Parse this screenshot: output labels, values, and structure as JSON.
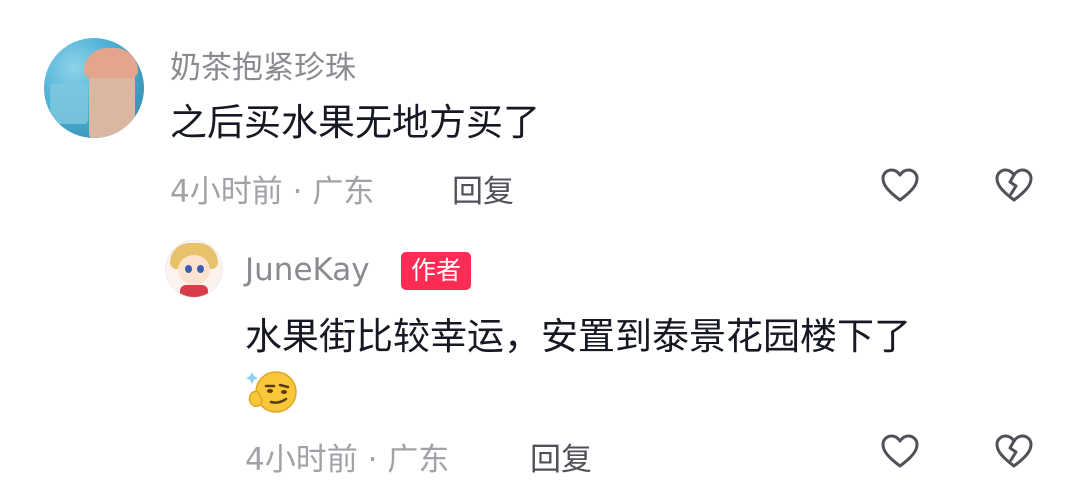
{
  "comment": {
    "username": "奶茶抱紧珍珠",
    "text": "之后买水果无地方买了",
    "time": "4小时前",
    "separator": "·",
    "location": "广东",
    "reply_label": "回复"
  },
  "reply": {
    "username": "JuneKay",
    "badge": "作者",
    "text": "水果街比较幸运，安置到泰景花园楼下了",
    "emoji": "smirk-emoji",
    "time": "4小时前",
    "separator": "·",
    "location": "广东",
    "reply_label": "回复"
  },
  "icons": {
    "like": "heart-outline-icon",
    "dislike": "broken-heart-icon"
  },
  "colors": {
    "badge_bg": "#fe2c55",
    "meta_text": "#a1a2a7",
    "username_text": "#8a8b91",
    "body_text": "#161823"
  }
}
